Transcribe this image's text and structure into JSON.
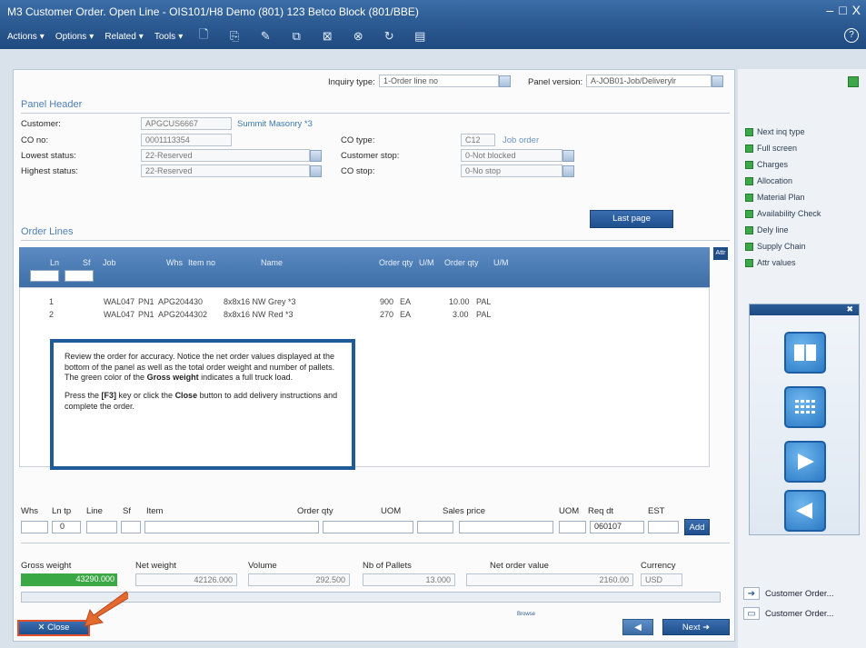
{
  "window": {
    "title": "M3 Customer Order. Open Line - OIS101/H8   Demo (801) 123 Betco Block (801/BBE)",
    "controls": [
      "–",
      "□",
      "X"
    ]
  },
  "menubar": {
    "actions": "Actions",
    "options": "Options",
    "related": "Related",
    "tools": "Tools",
    "help": "?"
  },
  "header": {
    "inquiry_type_label": "Inquiry type:",
    "inquiry_type_value": "1-Order line no",
    "panel_version_label": "Panel version:",
    "panel_version_value": "A-JOB01-Job/Deliverylr"
  },
  "panel_header": {
    "title": "Panel Header",
    "customer_label": "Customer:",
    "customer_value": "APGCUS6667",
    "customer_name": "Summit Masonry *3",
    "co_no_label": "CO no:",
    "co_no_value": "0001113354",
    "lowest_status_label": "Lowest status:",
    "lowest_status_value": "22-Reserved",
    "highest_status_label": "Highest status:",
    "highest_status_value": "22-Reserved",
    "co_type_label": "CO type:",
    "co_type_value": "C12",
    "co_type_desc": "Job order",
    "customer_stop_label": "Customer stop:",
    "customer_stop_value": "0-Not blocked",
    "co_stop_label": "CO stop:",
    "co_stop_value": "0-No stop",
    "last_page": "Last page"
  },
  "order_lines": {
    "title": "Order Lines",
    "attr_button": "Attr",
    "columns": [
      "Ln",
      "Sf",
      "Job",
      "Whs",
      "Item no",
      "Name",
      "Order qty",
      "U/M",
      "Order qty",
      "U/M"
    ],
    "rows": [
      {
        "ln": "1",
        "job": "WAL047",
        "whs": "PN1",
        "item": "APG204430",
        "name": "8x8x16 NW Grey *3",
        "qty": "900",
        "um": "EA",
        "qty2": "10.00",
        "um2": "PAL"
      },
      {
        "ln": "2",
        "job": "WAL047",
        "whs": "PN1",
        "item": "APG2044302",
        "name": "8x8x16 NW Red *3",
        "qty": "270",
        "um": "EA",
        "qty2": "3.00",
        "um2": "PAL"
      }
    ]
  },
  "callout": {
    "para1_a": "Review the order for accuracy. Notice the net order values displayed at the bottom of the panel as well as the total order weight and number of pallets. The green color of the ",
    "para1_bold": "Gross weight",
    "para1_b": " indicates a full truck load.",
    "para2_a": "Press the ",
    "para2_key": "[F3]",
    "para2_b": " key or click the ",
    "para2_close": "Close",
    "para2_c": " button to add delivery instructions and complete the order."
  },
  "entry": {
    "labels": [
      "Whs",
      "Ln tp",
      "Line",
      "Sf",
      "Item",
      "Order qty",
      "UOM",
      "Sales price",
      "UOM",
      "Req dt",
      "EST"
    ],
    "ln_tp_value": "0",
    "req_dt_value": "060107",
    "add_button": "Add"
  },
  "totals": {
    "gross_weight_label": "Gross weight",
    "gross_weight_value": "43290.000",
    "net_weight_label": "Net weight",
    "net_weight_value": "42126.000",
    "volume_label": "Volume",
    "volume_value": "292.500",
    "pallets_label": "Nb of Pallets",
    "pallets_value": "13.000",
    "net_order_value_label": "Net order value",
    "net_order_value": "2160.00",
    "currency_label": "Currency",
    "currency_value": "USD"
  },
  "footer": {
    "close": "Close",
    "next": "Next",
    "browse": "Browse"
  },
  "right_panel": {
    "links": [
      "Next inq type",
      "Full screen",
      "Charges",
      "Allocation",
      "Material Plan",
      "Availability Check",
      "Dely line",
      "Supply Chain",
      "Attr values"
    ],
    "tasks": [
      "Customer Order...",
      "Customer Order..."
    ]
  },
  "colors": {
    "accent": "#2c5a91",
    "gross_weight_ok": "#3aa845",
    "highlight": "#e0502d"
  }
}
